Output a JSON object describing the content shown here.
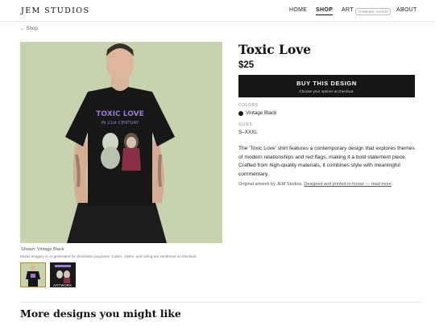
{
  "header": {
    "logo": "JEM STUDIOS",
    "nav": {
      "home": "HOME",
      "shop": "SHOP",
      "art": "ART",
      "art_badge": "COMING SOON",
      "about": "ABOUT"
    }
  },
  "breadcrumb": {
    "back": "← Shop"
  },
  "gallery": {
    "caption": "Shown: Vintage Black",
    "disclaimer": "Model imagery is AI-generated for illustrative purposes. Colors, styles, and sizing are confirmed at checkout.",
    "thumbnail_tag": "ARTWORK",
    "shirt_print": {
      "line1": "TOXIC LOVE",
      "line2": "IN 21st CENTURY"
    }
  },
  "product": {
    "title": "Toxic Love",
    "price": "$25",
    "buy_button": "BUY THIS DESIGN",
    "buy_subtext": "Choose your options at checkout.",
    "colors_label": "COLORS",
    "color_value": "Vintage Black",
    "sizes_label": "SIZES",
    "sizes_value": "S–XXXL",
    "description": "The 'Toxic Love' shirt features a contemporary design that explores themes of modern relationships and red flags, making it a bold statement piece. Crafted from high-quality materials, it combines style with meaningful commentary.",
    "original_text": "Original artwork by JEM Studios.",
    "original_link": "Designed and printed in-house — read more"
  },
  "more": {
    "heading": "More designs you might like"
  },
  "colors": {
    "accent": "#161616",
    "hero_bg": "#c7d2ae",
    "print_purple": "#9a78d6",
    "thumb_border": "#b88c1a"
  }
}
